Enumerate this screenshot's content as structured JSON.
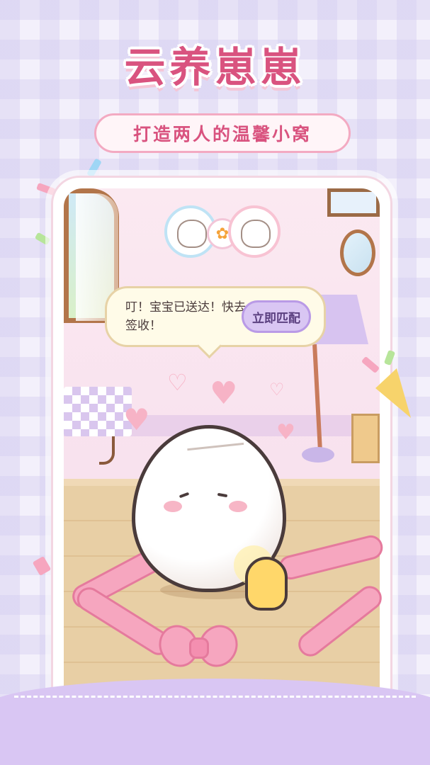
{
  "header": {
    "title": "云养崽崽",
    "subtitle": "打造两人的温馨小窝"
  },
  "dialog": {
    "message": "叮！宝宝已送达！快去签收！",
    "button_label": "立即匹配"
  },
  "colors": {
    "title_pink": "#d9537f",
    "button_purple": "#d9c6f3",
    "ribbon_pink": "#f6a6bf",
    "egg_white": "#ffffff"
  }
}
